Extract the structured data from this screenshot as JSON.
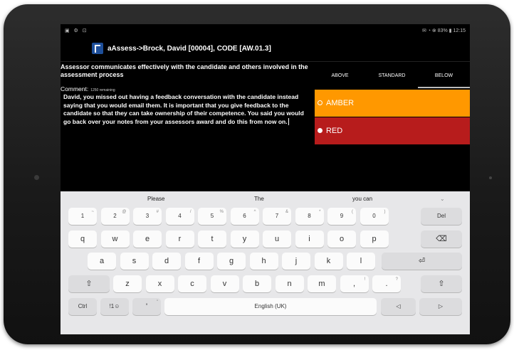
{
  "status": {
    "left_icons": "▣ ⚙ ⊡",
    "right": "✉ ◔ ⊗ 83% ▮ 12:15"
  },
  "app": {
    "title": "aAssess->Brock, David [00004], CODE [AW.01.3]"
  },
  "question": {
    "text": "Assessor communicates effectively with the candidate and others involved in the assessment process"
  },
  "comment": {
    "label": "Comment:",
    "count": "1250 remaining",
    "text": "David, you missed out having a feedback conversation with the candidate instead saying that you would email them. It is important that you give feedback to the candidate so that they can take ownership of their competence. You said you would go back over your notes from your assessors award and do this from now on."
  },
  "tabs": [
    "ABOVE",
    "STANDARD",
    "BELOW"
  ],
  "ratings": [
    {
      "label": "AMBER",
      "color": "#ff9800",
      "selected": false
    },
    {
      "label": "RED",
      "color": "#b71c1c",
      "selected": true
    }
  ],
  "keyboard": {
    "suggestions": [
      "Please",
      "The",
      "you can",
      "⌄"
    ],
    "row1": [
      [
        "1",
        "~"
      ],
      [
        "2",
        "@"
      ],
      [
        "3",
        "#"
      ],
      [
        "4",
        "/"
      ],
      [
        "5",
        "%"
      ],
      [
        "6",
        "^"
      ],
      [
        "7",
        "&"
      ],
      [
        "8",
        "*"
      ],
      [
        "9",
        "("
      ],
      [
        "0",
        ")"
      ]
    ],
    "row1_del": "Del",
    "row2": [
      "q",
      "w",
      "e",
      "r",
      "t",
      "y",
      "u",
      "i",
      "o",
      "p"
    ],
    "backspace": "⌫",
    "row3": [
      "a",
      "s",
      "d",
      "f",
      "g",
      "h",
      "j",
      "k",
      "l"
    ],
    "enter": "⏎",
    "shift": "⇧",
    "row4": [
      [
        "z",
        ""
      ],
      [
        "x",
        ""
      ],
      [
        "c",
        ""
      ],
      [
        "v",
        ""
      ],
      [
        "b",
        ""
      ],
      [
        "n",
        ""
      ],
      [
        "m",
        ""
      ],
      [
        ",",
        "!"
      ],
      [
        ".",
        "?"
      ]
    ],
    "ctrl": "Ctrl",
    "sym": "!1☺",
    "punct": [
      "'",
      "\""
    ],
    "space": "English (UK)",
    "left": "◁",
    "right": "▷"
  }
}
